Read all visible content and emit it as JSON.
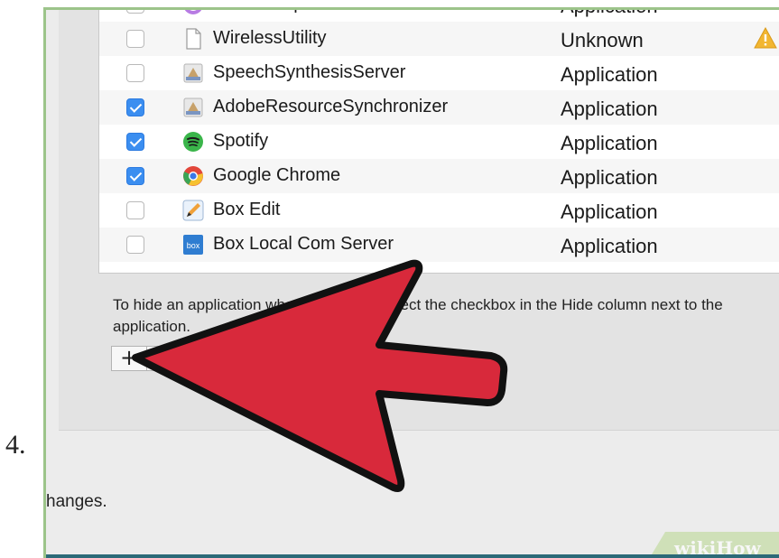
{
  "step_number": "4.",
  "table_rows": [
    {
      "name": "iTunesHelper",
      "kind": "Application",
      "checked": false,
      "icon": "itunes-helper-icon"
    },
    {
      "name": "WirelessUtility",
      "kind": "Unknown",
      "checked": false,
      "icon": "document-icon",
      "warning": true
    },
    {
      "name": "SpeechSynthesisServer",
      "kind": "Application",
      "checked": false,
      "icon": "app-generic-icon"
    },
    {
      "name": "AdobeResourceSynchronizer",
      "kind": "Application",
      "checked": true,
      "icon": "app-generic-icon"
    },
    {
      "name": "Spotify",
      "kind": "Application",
      "checked": true,
      "icon": "spotify-icon"
    },
    {
      "name": "Google Chrome",
      "kind": "Application",
      "checked": true,
      "icon": "chrome-icon"
    },
    {
      "name": "Box Edit",
      "kind": "Application",
      "checked": false,
      "icon": "box-edit-icon"
    },
    {
      "name": "Box Local Com Server",
      "kind": "Application",
      "checked": false,
      "icon": "box-icon"
    }
  ],
  "box_icon_text": "box",
  "hint_text": "To hide an application when you log in, select the checkbox in the Hide column next to the application.",
  "add_button_label": "+",
  "remove_button_label": "−",
  "footer_text": "hanges.",
  "watermark": "wikiHow",
  "colors": {
    "checkbox_on": "#3b8ef0",
    "arrow_red": "#d8293b",
    "bottom_bar": "#2c6a78",
    "frame_green": "#9cc48a"
  }
}
